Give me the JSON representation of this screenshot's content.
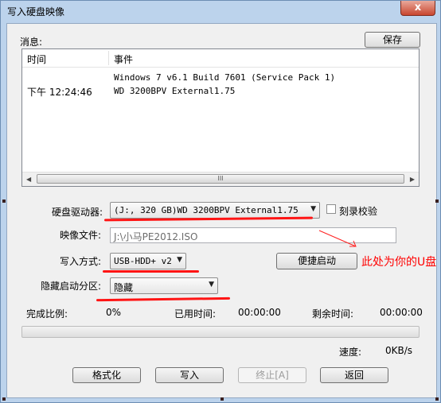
{
  "window": {
    "title": "写入硬盘映像",
    "close_glyph": "x"
  },
  "messages": {
    "label": "消息:",
    "save_button": "保存",
    "columns": {
      "time": "时间",
      "event": "事件"
    },
    "rows": [
      {
        "time": "",
        "event": "Windows 7 v6.1 Build 7601 (Service Pack 1)"
      },
      {
        "time": "下午 12:24:46",
        "event": "WD      3200BPV External1.75"
      }
    ],
    "scroll_grip": "III"
  },
  "form": {
    "drive_label": "硬盘驱动器:",
    "drive_value": "(J:, 320 GB)WD       3200BPV External1.75",
    "verify_label": "刻录校验",
    "image_label": "映像文件:",
    "image_value": "J:\\小马PE2012.ISO",
    "method_label": "写入方式:",
    "method_value": "USB-HDD+ v2",
    "quick_boot_button": "便捷启动",
    "hidden_label": "隐藏启动分区:",
    "hidden_value": "隐藏"
  },
  "annotation": {
    "text": "此处为你的U盘",
    "color": "#ff0000"
  },
  "progress": {
    "complete_label": "完成比例:",
    "complete_value": "0%",
    "elapsed_label": "已用时间:",
    "elapsed_value": "00:00:00",
    "remaining_label": "剩余时间:",
    "remaining_value": "00:00:00",
    "speed_label": "速度:",
    "speed_value": "0KB/s",
    "fraction": 0
  },
  "buttons": {
    "format": "格式化",
    "write": "写入",
    "stop": "终止[A]",
    "back": "返回"
  }
}
